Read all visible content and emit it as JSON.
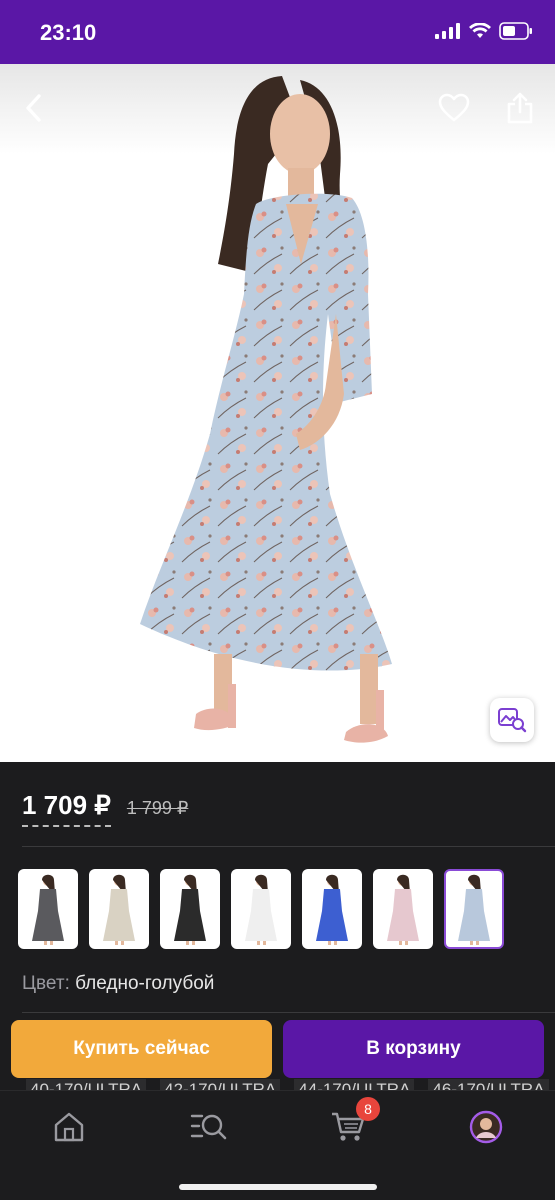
{
  "status_bar": {
    "time": "23:10"
  },
  "product": {
    "price": "1 709 ₽",
    "old_price": "1 799 ₽",
    "color_label": "Цвет:",
    "color_value": "бледно-голубой",
    "variants": [
      {
        "name": "grey",
        "dress_color": "#5a5a5e",
        "selected": false
      },
      {
        "name": "cream-print",
        "dress_color": "#d9d2c3",
        "selected": false
      },
      {
        "name": "black-floral",
        "dress_color": "#2b2b2b",
        "selected": false
      },
      {
        "name": "white",
        "dress_color": "#efefef",
        "selected": false
      },
      {
        "name": "blue",
        "dress_color": "#3d5fd1",
        "selected": false
      },
      {
        "name": "pink-floral",
        "dress_color": "#e6c8cf",
        "selected": false
      },
      {
        "name": "pale-blue",
        "dress_color": "#b8c8dc",
        "selected": true
      }
    ]
  },
  "sizes": [
    "40-170/ULTRA",
    "42-170/ULTRA",
    "44-170/ULTRA",
    "46-170/ULTRA"
  ],
  "buttons": {
    "buy_now": "Купить сейчас",
    "add_to_cart": "В корзину"
  },
  "tabbar": {
    "cart_badge": "8"
  },
  "colors": {
    "brand_purple": "#5a17a6",
    "buy_orange": "#f2a93b",
    "badge_red": "#e8453c",
    "background_dark": "#1c1c1e"
  }
}
